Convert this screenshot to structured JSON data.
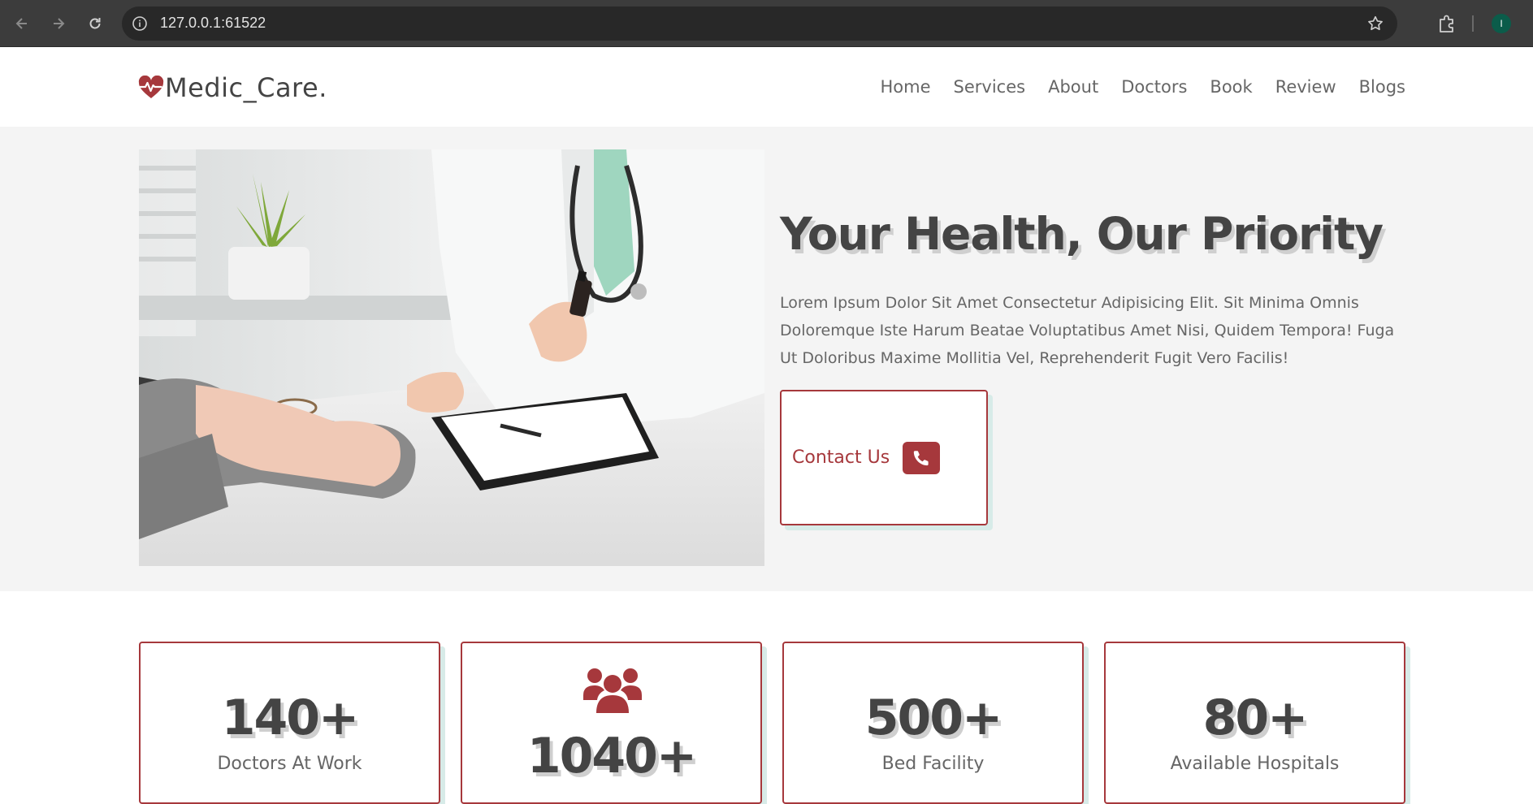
{
  "browser": {
    "url": "127.0.0.1:61522",
    "profile_initial": "I"
  },
  "header": {
    "logo_text": "Medic_Care.",
    "nav": [
      "Home",
      "Services",
      "About",
      "Doctors",
      "Book",
      "Review",
      "Blogs"
    ]
  },
  "hero": {
    "title": "Your Health, Our Priority",
    "description": "Lorem Ipsum Dolor Sit Amet Consectetur Adipisicing Elit. Sit Minima Omnis Doloremque Iste Harum Beatae Voluptatibus Amet Nisi, Quidem Tempora! Fuga Ut Doloribus Maxime Mollitia Vel, Reprehenderit Fugit Vero Facilis!",
    "contact_label": "Contact Us"
  },
  "stats": [
    {
      "number": "140+",
      "label": "Doctors At Work"
    },
    {
      "number": "1040+",
      "label": ""
    },
    {
      "number": "500+",
      "label": "Bed Facility"
    },
    {
      "number": "80+",
      "label": "Available Hospitals"
    }
  ],
  "colors": {
    "accent": "#a6383c",
    "shadow": "#d7ebe8",
    "hero_bg": "#f4f4f4"
  }
}
